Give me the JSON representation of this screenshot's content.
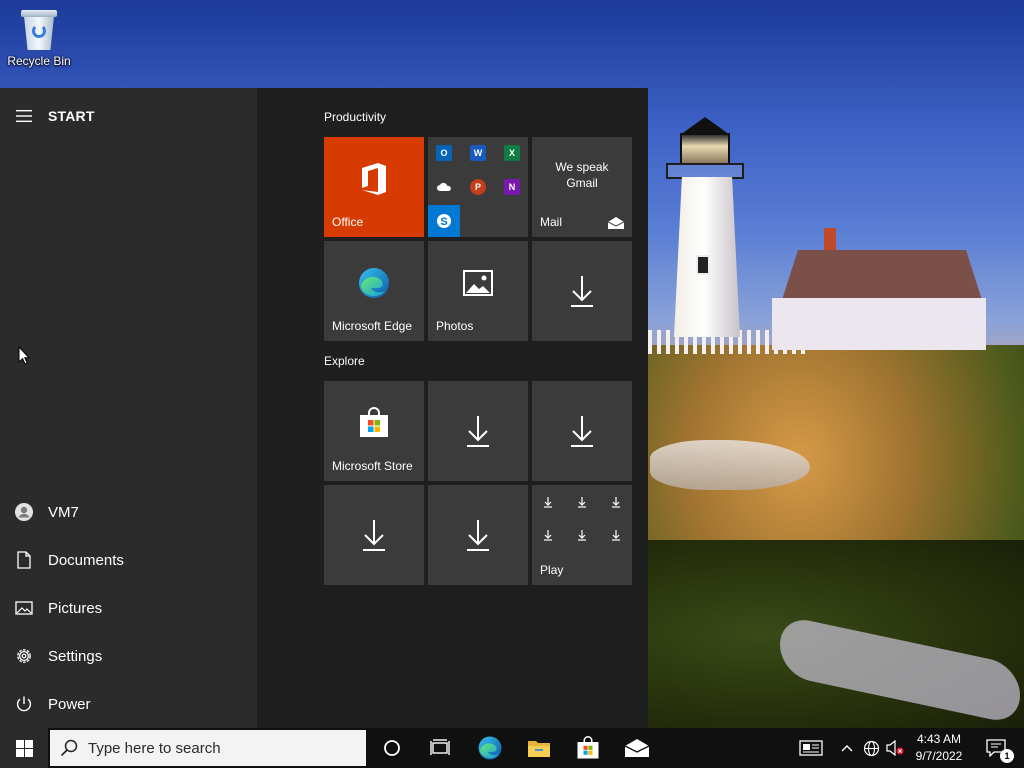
{
  "desktop": {
    "icons": [
      {
        "label": "Recycle Bin",
        "icon": "recycle-bin-icon"
      }
    ]
  },
  "start_menu": {
    "title": "START",
    "rail_items": [
      {
        "label": "VM7",
        "icon": "user-icon"
      },
      {
        "label": "Documents",
        "icon": "document-icon"
      },
      {
        "label": "Pictures",
        "icon": "pictures-icon"
      },
      {
        "label": "Settings",
        "icon": "gear-icon"
      },
      {
        "label": "Power",
        "icon": "power-icon"
      }
    ],
    "groups": [
      {
        "title": "Productivity",
        "tiles": [
          {
            "label": "Office",
            "icon": "office-icon",
            "color": "#d83b01"
          },
          {
            "label": "",
            "icon": "office-apps-folder"
          },
          {
            "label": "Mail",
            "text": "We speak Gmail",
            "icon": "mail-icon"
          },
          {
            "label": "Microsoft Edge",
            "icon": "edge-icon"
          },
          {
            "label": "Photos",
            "icon": "photos-icon"
          },
          {
            "label": "",
            "icon": "download-icon"
          }
        ]
      },
      {
        "title": "Explore",
        "tiles": [
          {
            "label": "Microsoft Store",
            "icon": "store-icon"
          },
          {
            "label": "",
            "icon": "download-icon"
          },
          {
            "label": "",
            "icon": "download-icon"
          },
          {
            "label": "",
            "icon": "download-icon"
          },
          {
            "label": "",
            "icon": "download-icon"
          },
          {
            "label": "Play",
            "icon": "play-folder"
          }
        ]
      }
    ],
    "office_apps": [
      "Outlook",
      "Word",
      "Excel",
      "OneDrive",
      "PowerPoint",
      "OneNote",
      "Skype"
    ]
  },
  "taskbar": {
    "search_placeholder": "Type here to search",
    "pinned": [
      "cortana-icon",
      "task-view-icon",
      "edge-icon",
      "file-explorer-icon",
      "store-icon",
      "mail-icon"
    ],
    "tray": [
      "news-icon",
      "chevron-up-icon",
      "network-icon",
      "volume-muted-icon"
    ],
    "time": "4:43 AM",
    "date": "9/7/2022",
    "notification_count": "1"
  },
  "colors": {
    "office_tile": "#d83b01",
    "tile_bg": "#3b3b3b",
    "start_bg": "#1f1f1f",
    "rail_bg": "#2b2b2b",
    "taskbar_bg": "#101010"
  }
}
